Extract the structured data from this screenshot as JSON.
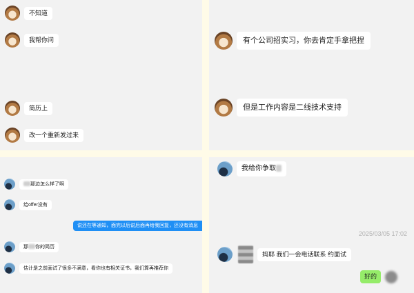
{
  "panel1": {
    "messages": [
      "不知道",
      "我帮你问",
      "简历上",
      "改一个重新发过来"
    ]
  },
  "panel2": {
    "messages": [
      "有个公司招实习，你去肯定手拿把捏",
      "但是工作内容是二线技术支持"
    ]
  },
  "panel3": {
    "messages": [
      {
        "before": "",
        "after": "那边怎么样了啊"
      },
      {
        "before": "",
        "after": "给offer没有"
      }
    ],
    "outgoing": "说还在等通知，面完以后说后面再给我回复，还没有消息",
    "messages2": [
      {
        "before": "那",
        "after": "你的简历"
      },
      {
        "before": "",
        "after": "估计是之前面试了很多不满意，看你也有相关证书，我们算再推荐你"
      }
    ]
  },
  "panel4": {
    "msg1_before": "我给你争取",
    "timestamp": "2025/03/05 17:02",
    "msg2": "妈耶 我们一会电话联系 约面试",
    "reply": "好的"
  }
}
